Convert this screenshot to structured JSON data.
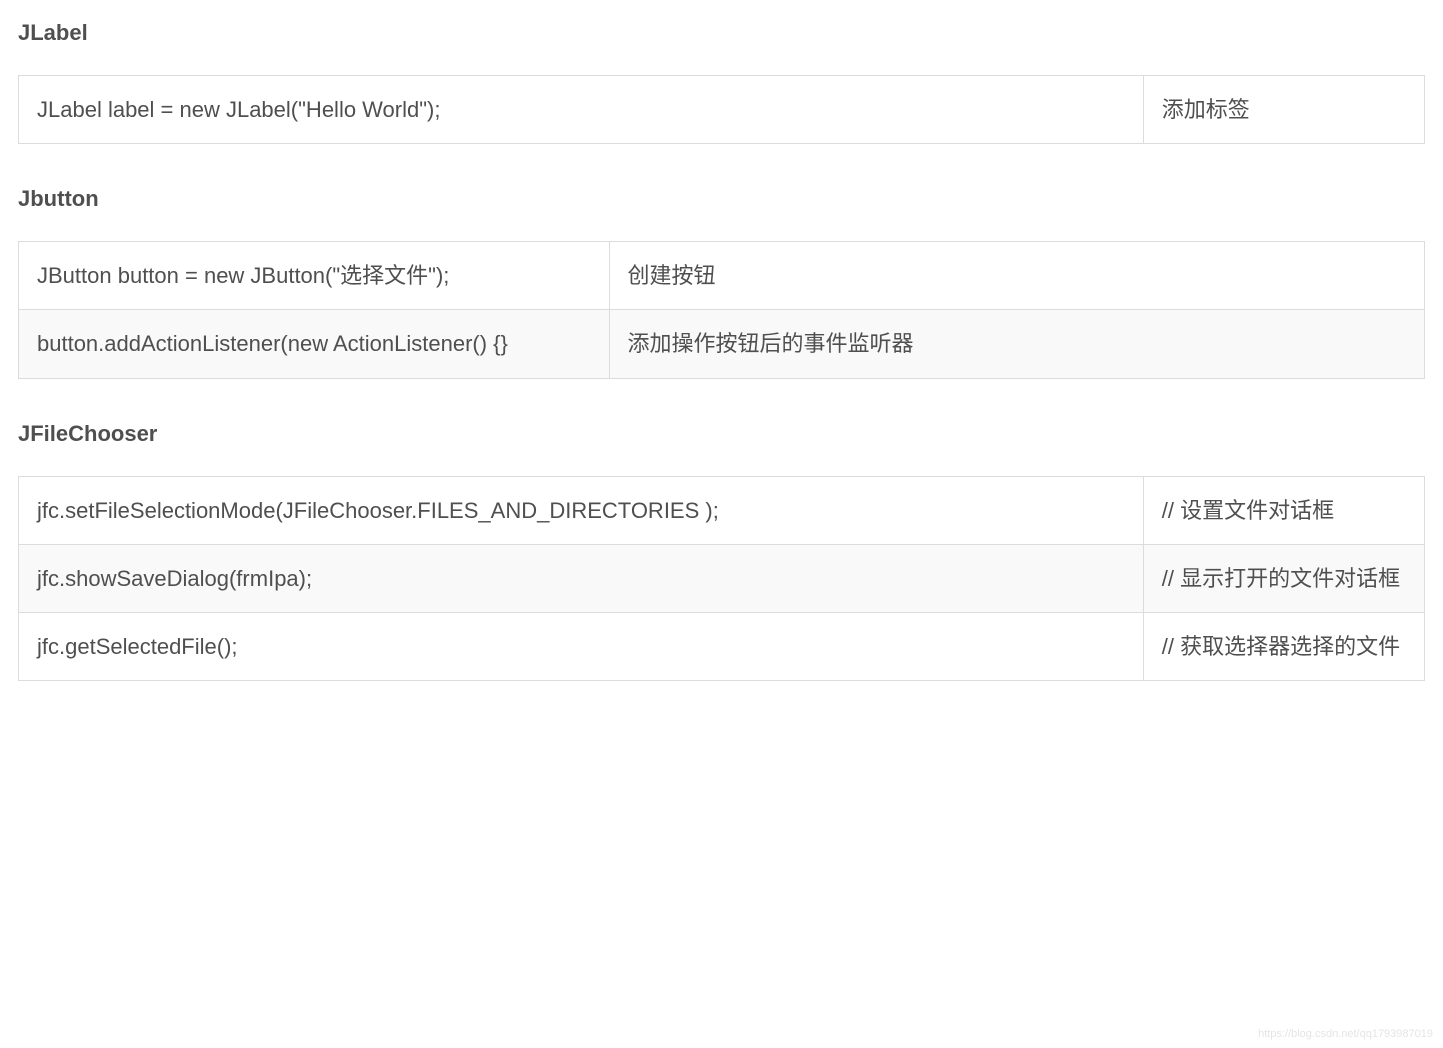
{
  "sections": [
    {
      "heading": "JLabel",
      "tableClass": "t1",
      "rows": [
        {
          "code": " JLabel label = new JLabel(\"Hello World\");",
          "desc": "添加标签"
        }
      ]
    },
    {
      "heading": "Jbutton",
      "tableClass": "t2",
      "rows": [
        {
          "code": "JButton button = new JButton(\"选择文件\");",
          "desc": "创建按钮"
        },
        {
          "code": "button.addActionListener(new ActionListener() {}",
          "desc": "添加操作按钮后的事件监听器"
        }
      ]
    },
    {
      "heading": "JFileChooser",
      "tableClass": "t3",
      "rows": [
        {
          "code": " jfc.setFileSelectionMode(JFileChooser.FILES_AND_DIRECTORIES );",
          "desc": "// 设置文件对话框"
        },
        {
          "code": "jfc.showSaveDialog(frmIpa);",
          "desc": "// 显示打开的文件对话框"
        },
        {
          "code": "jfc.getSelectedFile();",
          "desc": "// 获取选择器选择的文件"
        }
      ]
    }
  ],
  "watermark": "https://blog.csdn.net/qq1793987019"
}
